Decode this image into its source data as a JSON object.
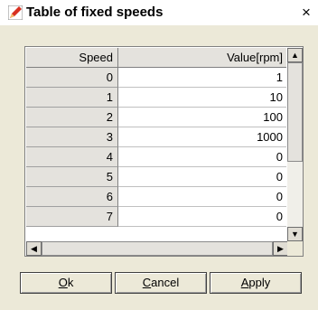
{
  "window": {
    "title": "Table of fixed speeds",
    "close_label": "×",
    "icon": "app-pencil-icon"
  },
  "table": {
    "columns": [
      "Speed",
      "Value[rpm]"
    ],
    "rows": [
      {
        "speed": "0",
        "value": "1"
      },
      {
        "speed": "1",
        "value": "10"
      },
      {
        "speed": "2",
        "value": "100"
      },
      {
        "speed": "3",
        "value": "1000"
      },
      {
        "speed": "4",
        "value": "0"
      },
      {
        "speed": "5",
        "value": "0"
      },
      {
        "speed": "6",
        "value": "0"
      },
      {
        "speed": "7",
        "value": "0"
      }
    ]
  },
  "scrollbar": {
    "up": "▲",
    "down": "▼",
    "left": "◀",
    "right": "▶"
  },
  "buttons": {
    "ok": {
      "mnemonic": "O",
      "rest": "k"
    },
    "cancel": {
      "mnemonic": "C",
      "rest": "ancel"
    },
    "apply": {
      "mnemonic": "A",
      "rest": "pply"
    }
  }
}
